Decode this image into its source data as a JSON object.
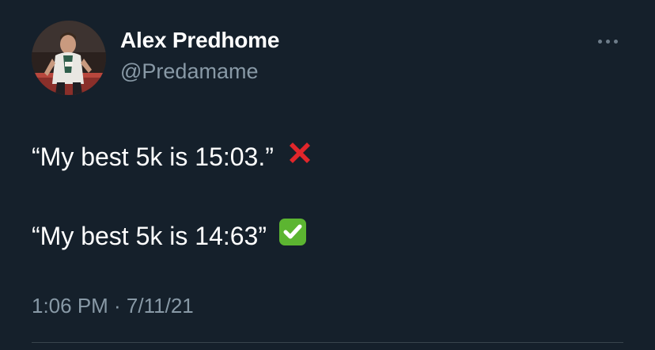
{
  "author": {
    "display_name": "Alex Predhome",
    "handle": "@Predamame"
  },
  "tweet": {
    "lines": [
      {
        "text": "“My best 5k is 15:03.”",
        "emoji": "red-cross-mark-icon"
      },
      {
        "text": "“My best 5k is 14:63”",
        "emoji": "green-check-mark-icon"
      }
    ],
    "timestamp": "1:06 PM · 7/11/21"
  },
  "icons": {
    "more": "more-options-icon"
  },
  "colors": {
    "background": "#15202b",
    "primary_text": "#ffffff",
    "secondary_text": "#8899a6",
    "cross_red": "#e0262b",
    "check_green": "#5cb531"
  }
}
